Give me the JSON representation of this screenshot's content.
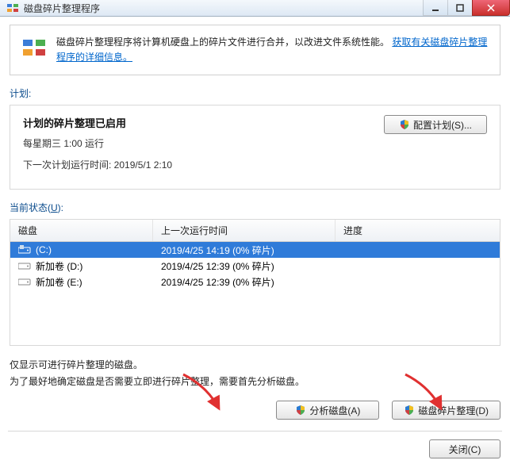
{
  "titlebar": {
    "title": "磁盘碎片整理程序"
  },
  "infobox": {
    "text": "磁盘碎片整理程序将计算机硬盘上的碎片文件进行合并，以改进文件系统性能。",
    "link": "获取有关磁盘碎片整理程序的详细信息。"
  },
  "plan": {
    "section_label_prefix": "计划",
    "title": "计划的碎片整理已启用",
    "schedule": "每星期三  1:00 运行",
    "next_run": "下一次计划运行时间: 2019/5/1 2:10",
    "configure_button": "配置计划(S)..."
  },
  "status": {
    "section_label_prefix": "当前状态(",
    "section_label_key": "U",
    "section_label_suffix": "):",
    "columns": {
      "c1": "磁盘",
      "c2": "上一次运行时间",
      "c3": "进度"
    },
    "rows": [
      {
        "name": "(C:)",
        "last_run": "2019/4/25 14:19 (0% 碎片)",
        "progress": "",
        "selected": true,
        "type": "os"
      },
      {
        "name": "新加卷 (D:)",
        "last_run": "2019/4/25 12:39 (0% 碎片)",
        "progress": "",
        "selected": false,
        "type": "data"
      },
      {
        "name": "新加卷 (E:)",
        "last_run": "2019/4/25 12:39 (0% 碎片)",
        "progress": "",
        "selected": false,
        "type": "data"
      }
    ]
  },
  "footer": {
    "line1": "仅显示可进行碎片整理的磁盘。",
    "line2": "为了最好地确定磁盘是否需要立即进行碎片整理，需要首先分析磁盘。"
  },
  "buttons": {
    "analyze": "分析磁盘(A)",
    "defrag": "磁盘碎片整理(D)",
    "close": "关闭(C)"
  }
}
